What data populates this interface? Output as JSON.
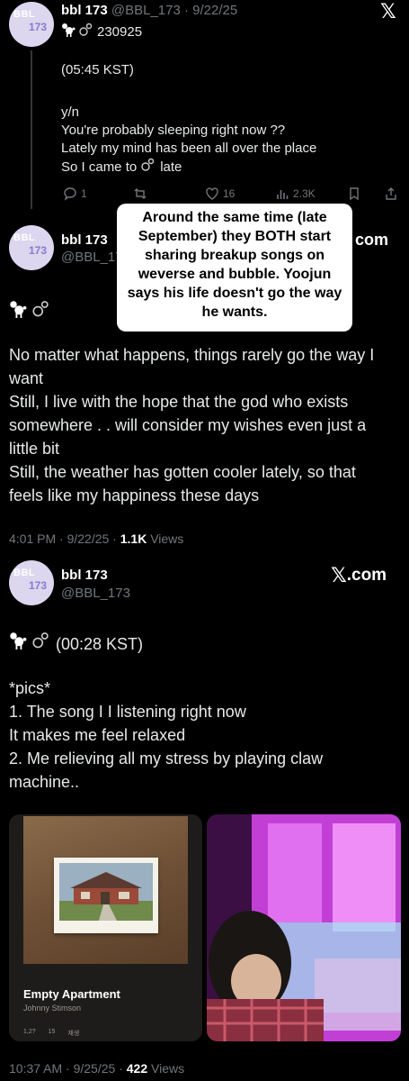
{
  "tweet1": {
    "avatar_line1": "BBL",
    "avatar_line2": "173",
    "name": "bbl 173",
    "handle_date": "@BBL_173 · 9/22/25",
    "header_line": "230925",
    "time": "(05:45 KST)",
    "lines": [
      "y/n",
      "You're probably sleeping right now ??",
      "Lately my mind has been all over the place",
      "So I came to",
      "late"
    ],
    "replies": "1",
    "likes": "16",
    "views": "2.3K"
  },
  "overlay_text": "Around the same time (late September) they BOTH start sharing breakup songs on weverse and bubble. Yoojun says his life doesn't go the way he wants.",
  "tweet2": {
    "avatar_line1": "BBL",
    "avatar_line2": "173",
    "name": "bbl 173",
    "handle": "@BBL_173",
    "logo_suffix": "com",
    "body": [
      "No matter what happens, things rarely go the way I",
      "want",
      "Still, I live with the hope that the god who exists",
      "somewhere . . will consider my wishes even just a",
      "little bit",
      "Still, the weather has gotten cooler lately, so that",
      "feels like my happiness these days"
    ],
    "timestamp": "4:01 PM · 9/22/25 · ",
    "views_count": "1.1K",
    "views_label": " Views"
  },
  "tweet3": {
    "avatar_line1": "BBL",
    "avatar_line2": "173",
    "name": "bbl 173",
    "handle": "@BBL_173",
    "logo_text": ".com",
    "time": "(00:28 KST)",
    "body": [
      "*pics*",
      "1. The song I I listening right now",
      "It makes me feel relaxed",
      "2. Me relieving all my stress by playing claw",
      "machine.."
    ],
    "song_title": "Empty Apartment",
    "song_artist": "Johnny Stimson",
    "song_stats": [
      "1,2?",
      "15",
      "재생"
    ],
    "timestamp": "10:37 AM · 9/25/25 · ",
    "views_count": "422",
    "views_label": " Views"
  },
  "icons": [
    "x-logo-icon",
    "poodle-icon",
    "bubble-icon",
    "reply-icon",
    "retweet-icon",
    "like-icon",
    "views-icon",
    "bookmark-icon",
    "share-icon"
  ]
}
